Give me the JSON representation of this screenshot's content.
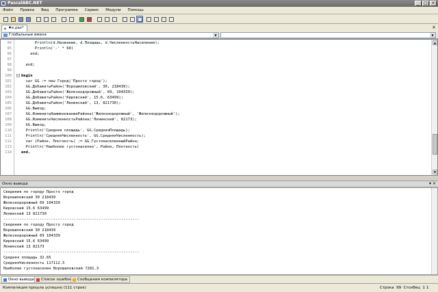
{
  "window": {
    "title": "PascalABC.NET",
    "minimize": "_",
    "maximize": "□",
    "close": "×"
  },
  "menu": [
    "Файл",
    "Правка",
    "Вид",
    "Программа",
    "Сервис",
    "Модули",
    "Помощь"
  ],
  "editor_tab": {
    "label": "♦e.pas*",
    "close": "×",
    "pin": "×"
  },
  "selector": {
    "left_value": "Глобальные имена",
    "right_value": "",
    "arrow": "▼"
  },
  "editor": {
    "lines": [
      {
        "num": "94",
        "text": "      Println(d.Название, d.Площадь, d.ЧисленностьНаселения);",
        "indent": 0,
        "bold": false
      },
      {
        "num": "95",
        "text": "      Println('-' * 60)",
        "indent": 0,
        "bold": false
      },
      {
        "num": "96",
        "text": "    end;",
        "indent": 0,
        "bold": false
      },
      {
        "num": "97",
        "text": "",
        "indent": 0,
        "bold": false
      },
      {
        "num": "98",
        "text": "  end;",
        "indent": 0,
        "bold": false
      },
      {
        "num": "99",
        "text": "",
        "indent": 0,
        "bold": false
      },
      {
        "num": "100",
        "text": "begin",
        "indent": 0,
        "bold": true
      },
      {
        "num": "101",
        "text": "  var GG := new Город('Просто город');",
        "indent": 0,
        "bold": false
      },
      {
        "num": "102",
        "text": "  GG.ДобавитьРайон('Ворошиловский', 30, 218439);",
        "indent": 0,
        "bold": false
      },
      {
        "num": "103",
        "text": "  GG.ДобавитьРайон('Железнодорожный', 69, 104339);",
        "indent": 0,
        "bold": false
      },
      {
        "num": "104",
        "text": "  GG.ДобавитьРайон('Кировский', 15.6, 63499);",
        "indent": 0,
        "bold": false
      },
      {
        "num": "105",
        "text": "  GG.ДобавитьРайон('Ленинский', 13, 821730);",
        "indent": 0,
        "bold": false
      },
      {
        "num": "106",
        "text": "  GG.Вывод;",
        "indent": 0,
        "bold": false
      },
      {
        "num": "107",
        "text": "  GG.ИзменитьНаименованиеРайона('Железнодорожный', 'Железнодорожный');",
        "indent": 0,
        "bold": false
      },
      {
        "num": "108",
        "text": "  GG.ИзменитьЧисленностьРайона('Ленинский', 82173);",
        "indent": 0,
        "bold": false
      },
      {
        "num": "109",
        "text": "  GG.Вывод;",
        "indent": 0,
        "bold": false
      },
      {
        "num": "110",
        "text": "  Println('Средняя площадь', GG.СредняяПлощадь);",
        "indent": 0,
        "bold": false
      },
      {
        "num": "111",
        "text": "  Println('СредняяЧисленность', GG.СредняяЧисленность);",
        "indent": 0,
        "bold": false
      },
      {
        "num": "112",
        "text": "  var (Район, Плотность) := GG.ГустонаселенныйРайон;",
        "indent": 0,
        "bold": false
      },
      {
        "num": "113",
        "text": "  Println('Наиболее густонаселен', Район, Плотность)",
        "indent": 0,
        "bold": false
      },
      {
        "num": "114",
        "text": "end.",
        "indent": 0,
        "bold": true
      }
    ]
  },
  "output_panel": {
    "title": "Окно вывода",
    "controls": "▾ ×",
    "lines": [
      "Сведения по городу Просто город",
      "Ворошиловский 30 218439",
      "Железнодорожный 69 104339",
      "Кировский 15.6 63499",
      "Ленинский 13 821730",
      "------------------------------------------------------------",
      "Сведения по городу Просто город",
      "Ворошиловский 30 218439",
      "Железнодорожный 69 104339",
      "Кировский 15.6 63499",
      "Ленинский 13 82173",
      "------------------------------------------------------------",
      "Средняя площадь 32.65",
      "СредняяЧисленность 117112.5",
      "Наиболее густонаселен Ворошиловский 7281.3"
    ]
  },
  "bottom_tabs": [
    "Окно вывода",
    "Список ошибок",
    "Сообщения компилятора"
  ],
  "status": {
    "message": "Компиляция прошла успешно (111 строк)",
    "position": "Строка  99  Столбец  1",
    "extra": "1"
  }
}
